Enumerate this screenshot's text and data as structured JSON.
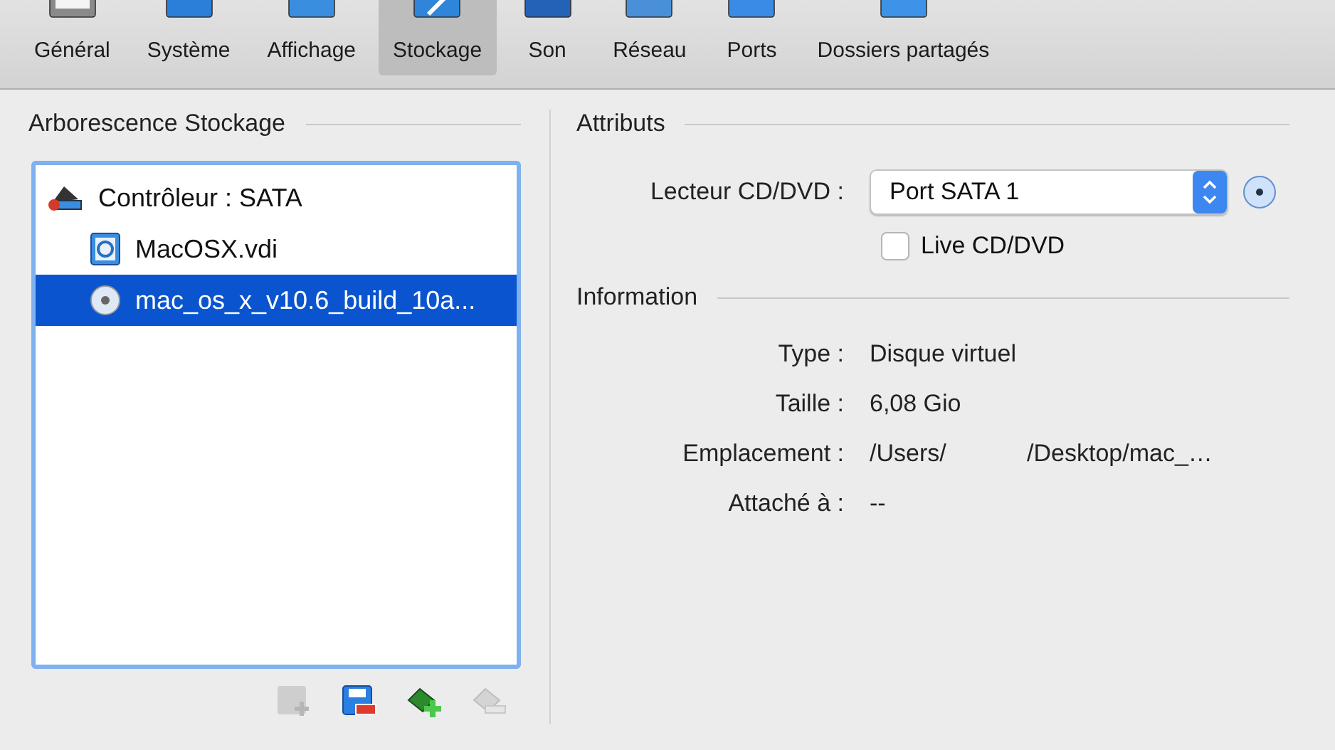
{
  "toolbar": [
    {
      "label": "Général",
      "selected": false
    },
    {
      "label": "Système",
      "selected": false
    },
    {
      "label": "Affichage",
      "selected": false
    },
    {
      "label": "Stockage",
      "selected": true
    },
    {
      "label": "Son",
      "selected": false
    },
    {
      "label": "Réseau",
      "selected": false
    },
    {
      "label": "Ports",
      "selected": false
    },
    {
      "label": "Dossiers partagés",
      "selected": false
    }
  ],
  "storage_tree": {
    "title": "Arborescence Stockage",
    "controller": {
      "label": "Contrôleur : SATA",
      "selected": false,
      "children": [
        {
          "label": "MacOSX.vdi",
          "kind": "disk",
          "selected": false
        },
        {
          "label": "mac_os_x_v10.6_build_10a...",
          "kind": "optical",
          "selected": true
        }
      ]
    },
    "actions": [
      {
        "kind": "add-attachment",
        "disabled": true
      },
      {
        "kind": "remove-attachment",
        "disabled": false
      },
      {
        "kind": "add-controller",
        "disabled": false
      },
      {
        "kind": "remove-controller",
        "disabled": true
      }
    ]
  },
  "attributes": {
    "title": "Attributs",
    "drive_label": "Lecteur CD/DVD :",
    "drive_value": "Port SATA 1",
    "live_label": "Live CD/DVD",
    "live_checked": false
  },
  "information": {
    "title": "Information",
    "rows": [
      {
        "label": "Type :",
        "value": "Disque virtuel"
      },
      {
        "label": "Taille :",
        "value": "6,08 Gio"
      },
      {
        "label": "Emplacement :",
        "value": "/Users/            /Desktop/mac_…"
      },
      {
        "label": "Attaché à :",
        "value": "--"
      }
    ]
  }
}
